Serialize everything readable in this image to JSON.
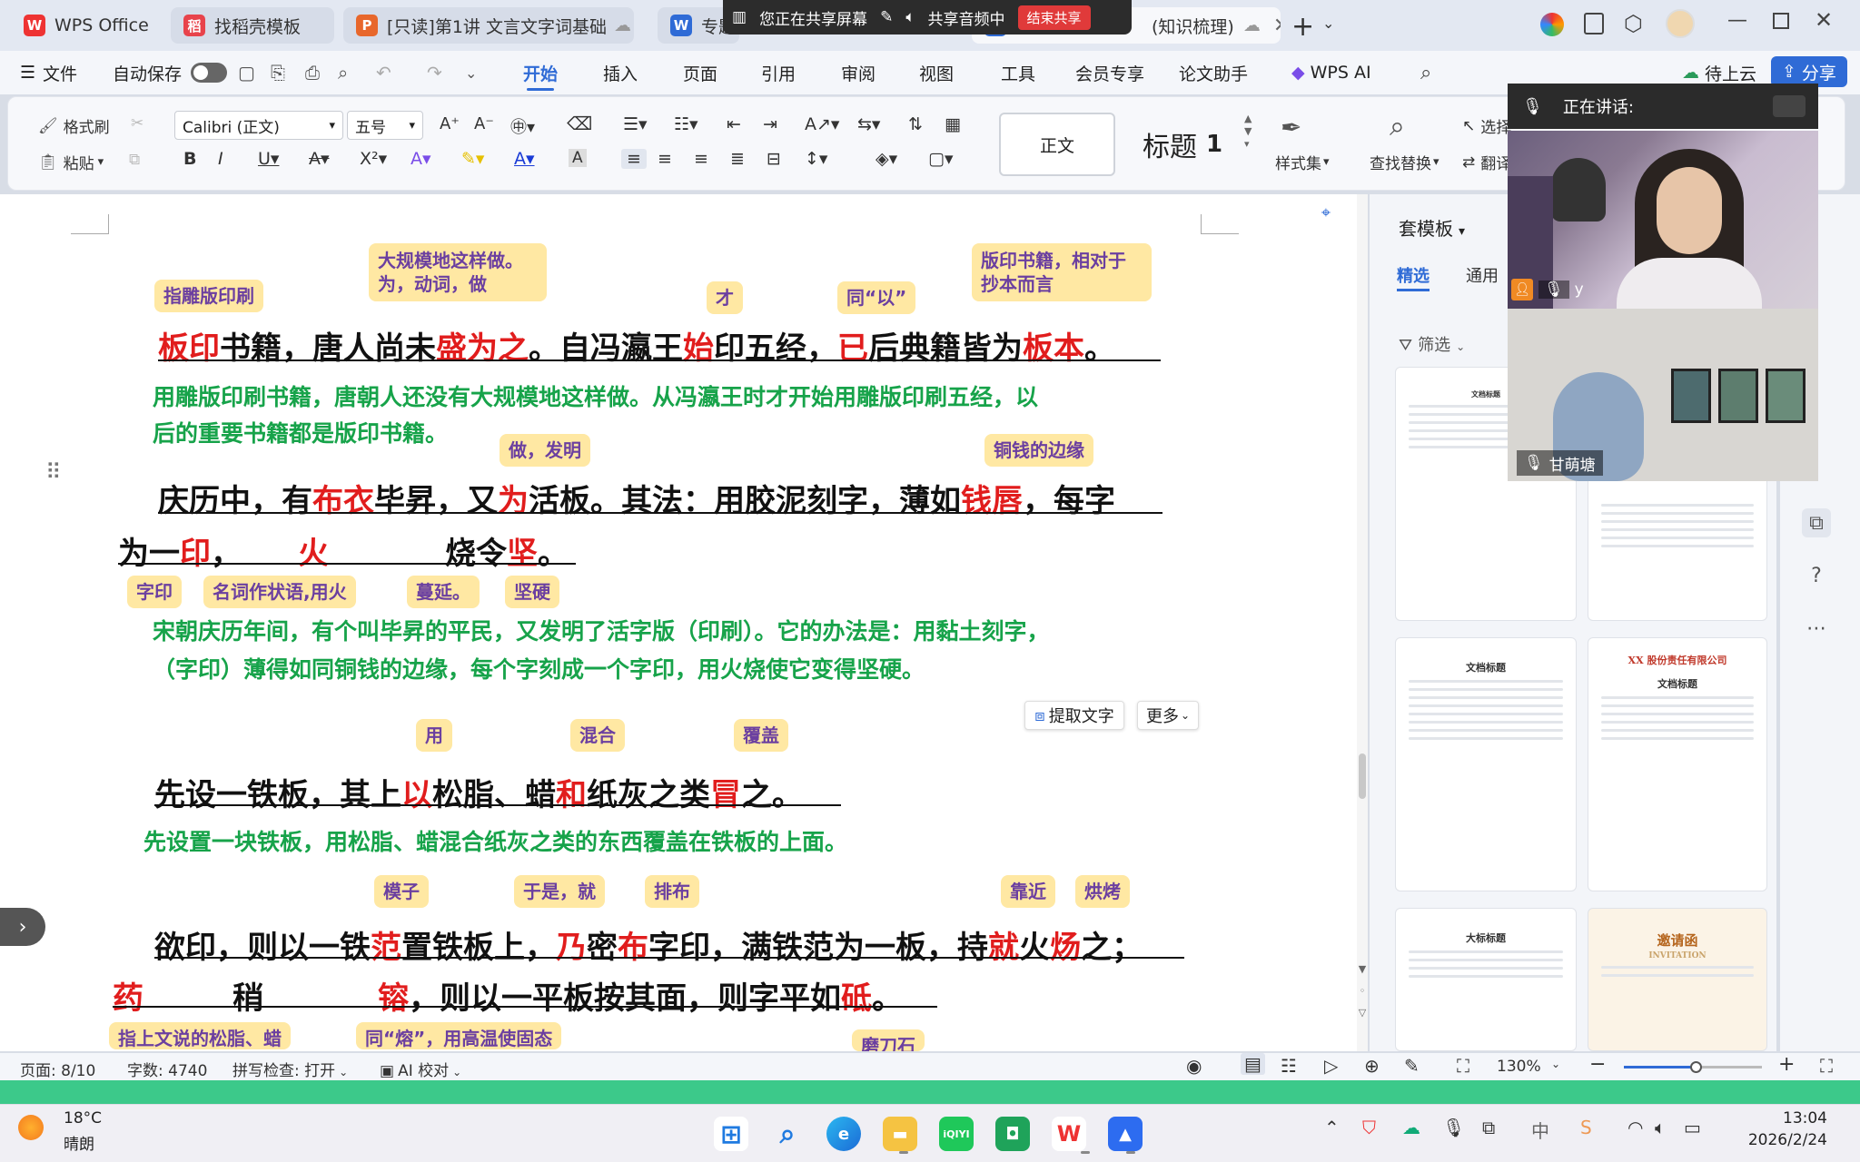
{
  "tabs": [
    {
      "label": "WPS Office",
      "icon": "wps-logo-icon"
    },
    {
      "label": "找稻壳模板",
      "icon": "docer-icon"
    },
    {
      "label": "[只读]第1讲 文言文字词基础",
      "icon": "ppt-icon"
    },
    {
      "label": "专题",
      "icon": "word-icon"
    },
    {
      "label": "(知识梳理)",
      "icon": "word-icon"
    }
  ],
  "share_bar": {
    "sharing": "您正在共享屏幕",
    "audio": "共享音频中",
    "end": "结束共享"
  },
  "menu": {
    "file": "文件",
    "autosave": "自动保存",
    "items": [
      "开始",
      "插入",
      "页面",
      "引用",
      "审阅",
      "视图",
      "工具",
      "会员专享",
      "论文助手"
    ],
    "wps_ai": "WPS AI",
    "pending_cloud": "待上云",
    "share": "分享"
  },
  "ribbon": {
    "format_painter": "格式刷",
    "paste": "粘贴",
    "font_name": "Calibri (正文)",
    "font_size": "五号",
    "style_normal": "正文",
    "style_heading": "标题",
    "style_heading_num": "1",
    "style_set": "样式集",
    "find_replace": "查找替换",
    "select": "选择",
    "translate": "翻译"
  },
  "doc": {
    "l1": [
      [
        "板印",
        "r"
      ],
      [
        "书籍，唐人尚未",
        ""
      ],
      [
        "盛为之",
        "r"
      ],
      [
        "。自冯瀛王",
        ""
      ],
      [
        "始",
        "r"
      ],
      [
        "印五经，",
        ""
      ],
      [
        "已",
        "r"
      ],
      [
        "后典籍皆为",
        ""
      ],
      [
        "板本",
        "r"
      ],
      [
        "。",
        ""
      ]
    ],
    "g1a": "用雕版印刷书籍，唐朝人还没有大规模地这样做。从冯瀛王时才开始用雕版印刷五经，以",
    "g1b": "后的重要书籍都是版印书籍。",
    "l2": [
      [
        "庆历中，有",
        ""
      ],
      [
        "布衣",
        "r"
      ],
      [
        "毕昇，又",
        ""
      ],
      [
        "为",
        "r"
      ],
      [
        "活板。其法：用胶泥刻字，薄如",
        ""
      ],
      [
        "钱唇",
        "r"
      ],
      [
        "，每字",
        ""
      ]
    ],
    "l3": [
      [
        "为一",
        ""
      ],
      [
        "印",
        "r"
      ],
      [
        "，",
        ""
      ]
    ],
    "l3b": "火",
    "l3c": [
      [
        "烧令",
        ""
      ],
      [
        "坚",
        "r"
      ],
      [
        "。",
        ""
      ]
    ],
    "g2a": "宋朝庆历年间，有个叫毕昇的平民，又发明了活字版（印刷）。它的办法是：用黏土刻字，",
    "g2b": "（字印）薄得如同铜钱的边缘，每个字刻成一个字印，用火烧使它变得坚硬。",
    "l4": [
      [
        "先设一铁板，其上",
        ""
      ],
      [
        "以",
        "r"
      ],
      [
        "松脂、蜡",
        ""
      ],
      [
        "和",
        "r"
      ],
      [
        "纸灰之类",
        ""
      ],
      [
        "冒",
        "r"
      ],
      [
        "之。",
        ""
      ]
    ],
    "g3": "先设置一块铁板，用松脂、蜡混合纸灰之类的东西覆盖在铁板的上面。",
    "l5": [
      [
        "欲印，则以一铁",
        ""
      ],
      [
        "范",
        "r"
      ],
      [
        "置铁板上，",
        ""
      ],
      [
        "乃",
        "r"
      ],
      [
        "密",
        ""
      ],
      [
        "布",
        "r"
      ],
      [
        "字印，满铁范为一板，持",
        ""
      ],
      [
        "就",
        "r"
      ],
      [
        "火",
        ""
      ],
      [
        "炀",
        "r"
      ],
      [
        "之；",
        ""
      ]
    ],
    "l6a": "药",
    "l6b": "稍",
    "l6c": [
      [
        "镕",
        "r"
      ],
      [
        "，则以一平板按其面，则字平如",
        ""
      ],
      [
        "砥",
        "r"
      ],
      [
        "。",
        ""
      ]
    ]
  },
  "notes": {
    "n1": "指雕版印刷",
    "n2": "大规模地这样做。为，动词，做",
    "n3": "才",
    "n4": "同“以”",
    "n5": "版印书籍，相对于抄本而言",
    "n6": "做，发明",
    "n7": "铜钱的边缘",
    "n8": "字印",
    "n9": "名词作状语,用火",
    "n10": "蔓延。",
    "n11": "坚硬",
    "n12": "用",
    "n13": "混合",
    "n14": "覆盖",
    "n15": "模子",
    "n16": "于是，就",
    "n17": "排布",
    "n18": "靠近",
    "n19": "烘烤",
    "n20": "指上文说的松脂、蜡",
    "n21": "同“熔”，用高温使固态",
    "n22": "磨刀石"
  },
  "float_buttons": {
    "extract": "提取文字",
    "more": "更多"
  },
  "panel": {
    "title": "套模板",
    "tabs": [
      "精选",
      "通用"
    ],
    "filter": "筛选",
    "thumb_titles": [
      "文档标题",
      "XX 股份责任有限公司",
      "文档标题",
      "大标标题",
      "邀请函",
      "INVITATION"
    ]
  },
  "video": {
    "speaking_label": "正在讲话:",
    "user1": "y",
    "user2": "甘萌塘"
  },
  "status": {
    "page": "页面: 8/10",
    "words": "字数: 4740",
    "spell": "拼写检查: 打开",
    "ai": "AI 校对",
    "zoom": "130%"
  },
  "zoom_fraction": 0.52,
  "taskbar": {
    "weather_temp": "18°C",
    "weather_desc": "晴朗",
    "time": "13:04",
    "date": "2026/2/24"
  },
  "colors": {
    "accent": "#2f6bd6",
    "red": "#e11d1d",
    "green": "#17a34a",
    "note": "#ffe8a3",
    "noteText": "#6b3fa0"
  }
}
